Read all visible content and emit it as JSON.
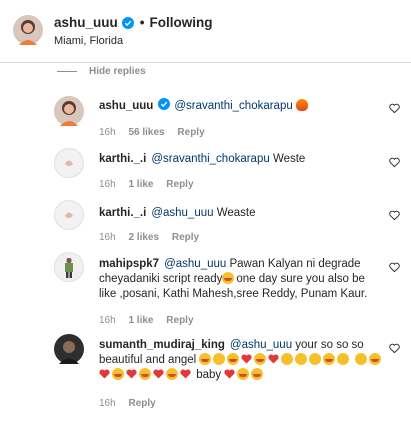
{
  "header": {
    "username": "ashu_uuu",
    "dot": "•",
    "follow_status": "Following",
    "location": "Miami, Florida"
  },
  "hide_replies_label": "Hide replies",
  "comments": [
    {
      "username": "ashu_uuu",
      "verified": true,
      "mention": "@sravanthi_chokarapu",
      "text": "",
      "time": "16h",
      "likes": "56 likes",
      "reply": "Reply"
    },
    {
      "username": "karthi._.i",
      "mention": "@sravanthi_chokarapu",
      "text": " Weste",
      "time": "16h",
      "likes": "1 like",
      "reply": "Reply"
    },
    {
      "username": "karthi._.i",
      "mention": "@ashu_uuu",
      "text": " Weaste",
      "time": "16h",
      "likes": "2 likes",
      "reply": "Reply"
    },
    {
      "username": "mahipspk7",
      "mention": "@ashu_uuu",
      "text_before_emoji": " Pawan Kalyan ni degrade cheyadaniki script ready",
      "text_after_emoji": "one day sure you also be like ,posani, Kathi Mahesh,sree Reddy, Punam Kaur.",
      "time": "16h",
      "likes": "1 like",
      "reply": "Reply"
    },
    {
      "username": "sumanth_mudiraj_king",
      "mention": "@ashu_uuu",
      "text": " your so so so beautiful and angel",
      "text_end": "baby",
      "time": "16h",
      "reply": "Reply"
    }
  ],
  "colors": {
    "verified": "#0095f6",
    "mention": "#00376b",
    "meta": "#8e8e8e",
    "emoji_heart": "#e23a3a"
  }
}
